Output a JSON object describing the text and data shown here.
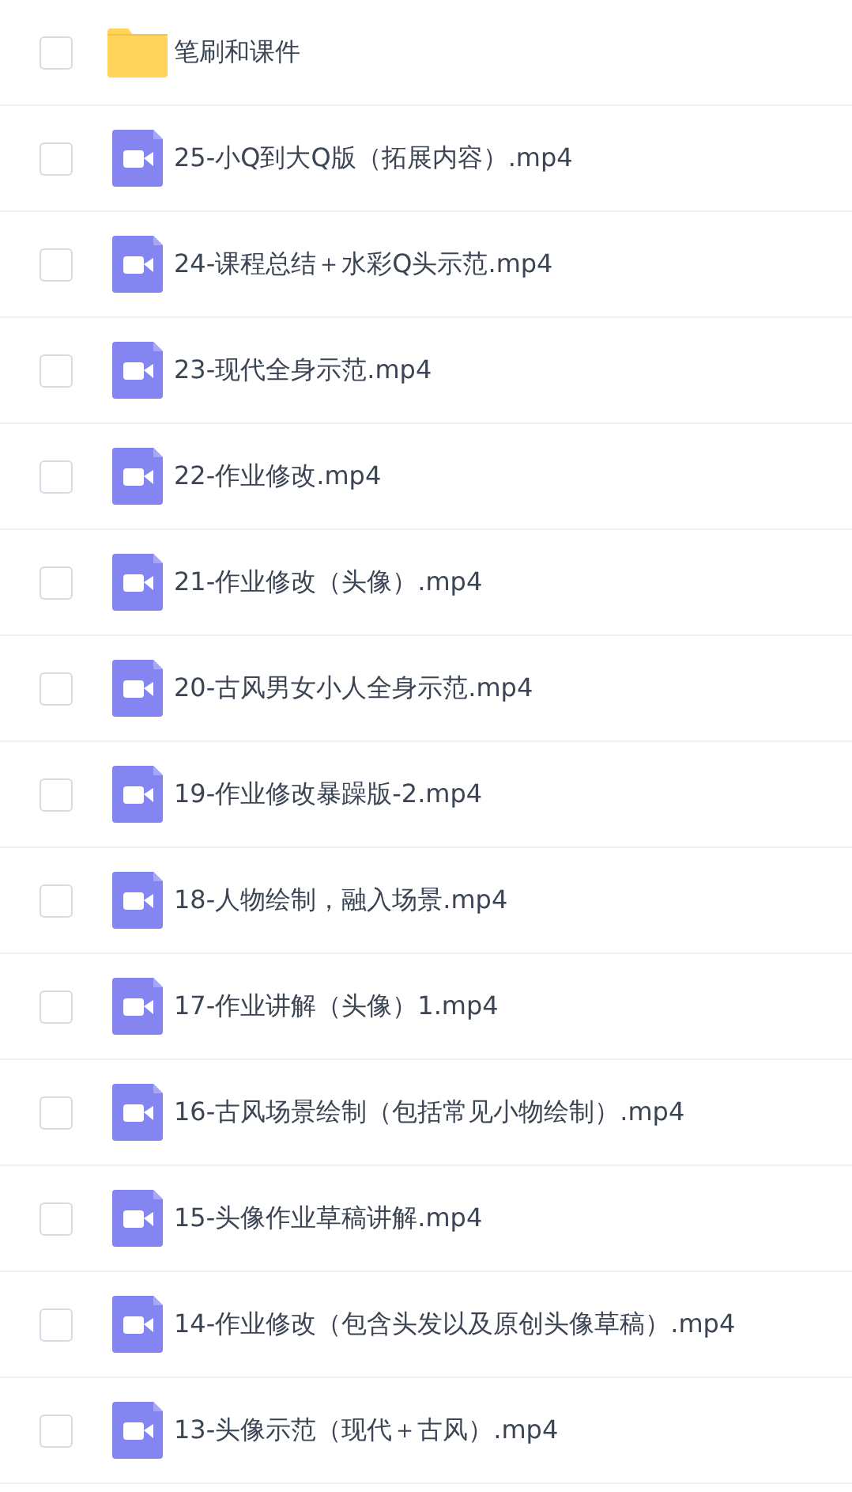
{
  "files": [
    {
      "kind": "folder",
      "name": "笔刷和课件",
      "checked": false
    },
    {
      "kind": "video",
      "name": "25-小Q到大Q版（拓展内容）.mp4",
      "checked": false
    },
    {
      "kind": "video",
      "name": "24-课程总结＋水彩Q头示范.mp4",
      "checked": false
    },
    {
      "kind": "video",
      "name": "23-现代全身示范.mp4",
      "checked": false
    },
    {
      "kind": "video",
      "name": "22-作业修改.mp4",
      "checked": false
    },
    {
      "kind": "video",
      "name": "21-作业修改（头像）.mp4",
      "checked": false
    },
    {
      "kind": "video",
      "name": "20-古风男女小人全身示范.mp4",
      "checked": false
    },
    {
      "kind": "video",
      "name": "19-作业修改暴躁版-2.mp4",
      "checked": false
    },
    {
      "kind": "video",
      "name": "18-人物绘制，融入场景.mp4",
      "checked": false
    },
    {
      "kind": "video",
      "name": "17-作业讲解（头像）1.mp4",
      "checked": false
    },
    {
      "kind": "video",
      "name": "16-古风场景绘制（包括常见小物绘制）.mp4",
      "checked": false
    },
    {
      "kind": "video",
      "name": "15-头像作业草稿讲解.mp4",
      "checked": false
    },
    {
      "kind": "video",
      "name": "14-作业修改（包含头发以及原创头像草稿）.mp4",
      "checked": false
    },
    {
      "kind": "video",
      "name": "13-头像示范（现代＋古风）.mp4",
      "checked": false
    }
  ]
}
